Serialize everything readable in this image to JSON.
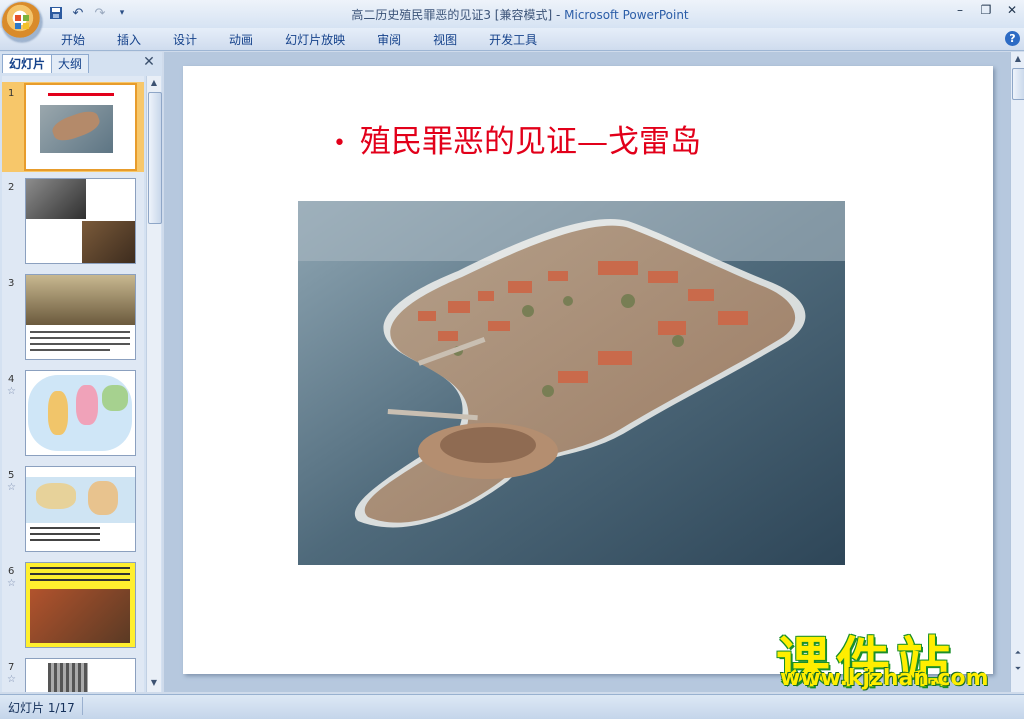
{
  "window": {
    "title": "高二历史殖民罪恶的见证3 [兼容模式] - ",
    "app_name": "Microsoft PowerPoint"
  },
  "quick_access": [
    "save-icon",
    "undo-icon",
    "redo-icon",
    "customize-icon"
  ],
  "ribbon": {
    "tabs": [
      "开始",
      "插入",
      "设计",
      "动画",
      "幻灯片放映",
      "审阅",
      "视图",
      "开发工具"
    ]
  },
  "panel": {
    "tabs": [
      "幻灯片",
      "大纲"
    ],
    "close": "✕"
  },
  "thumbnails": [
    {
      "num": "1",
      "star": "",
      "selected": true
    },
    {
      "num": "2",
      "star": ""
    },
    {
      "num": "3",
      "star": ""
    },
    {
      "num": "4",
      "star": "☆"
    },
    {
      "num": "5",
      "star": "☆"
    },
    {
      "num": "6",
      "star": "☆"
    },
    {
      "num": "7",
      "star": "☆"
    }
  ],
  "slide": {
    "bullet": "•",
    "title": "殖民罪恶的见证—戈雷岛"
  },
  "watermark": {
    "main": "课件站",
    "url": "www.kjzhan.com"
  },
  "status": {
    "slide_indicator": "幻灯片 1/17"
  },
  "colors": {
    "title_red": "#e2001a",
    "watermark_yellow": "#ffee00",
    "watermark_green": "#1a8f2a"
  }
}
